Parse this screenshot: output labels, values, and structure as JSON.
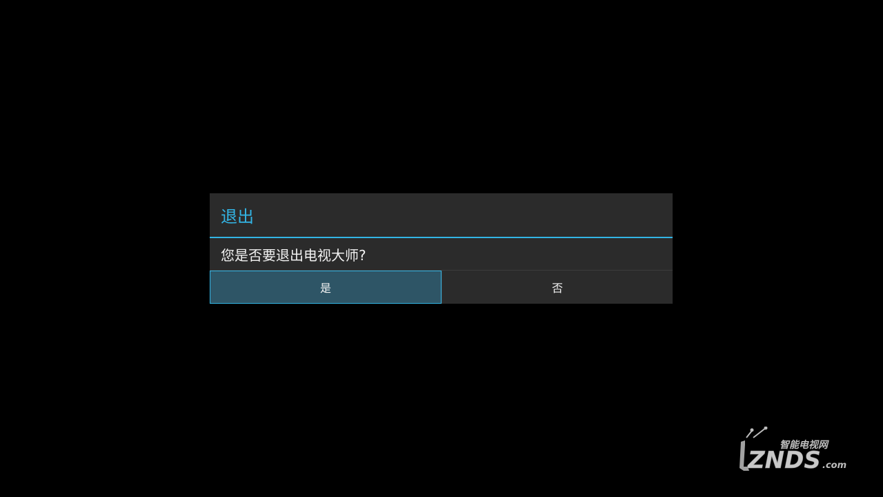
{
  "dialog": {
    "title": "退出",
    "message": "您是否要退出电视大师?",
    "confirm_label": "是",
    "cancel_label": "否"
  },
  "watermark": {
    "brand": "ZNDS",
    "suffix": ".com",
    "tagline": "智能电视网"
  },
  "colors": {
    "accent": "#33b5e5",
    "dialog_bg": "#2b2b2b",
    "focused_button_bg": "#2e5566"
  }
}
